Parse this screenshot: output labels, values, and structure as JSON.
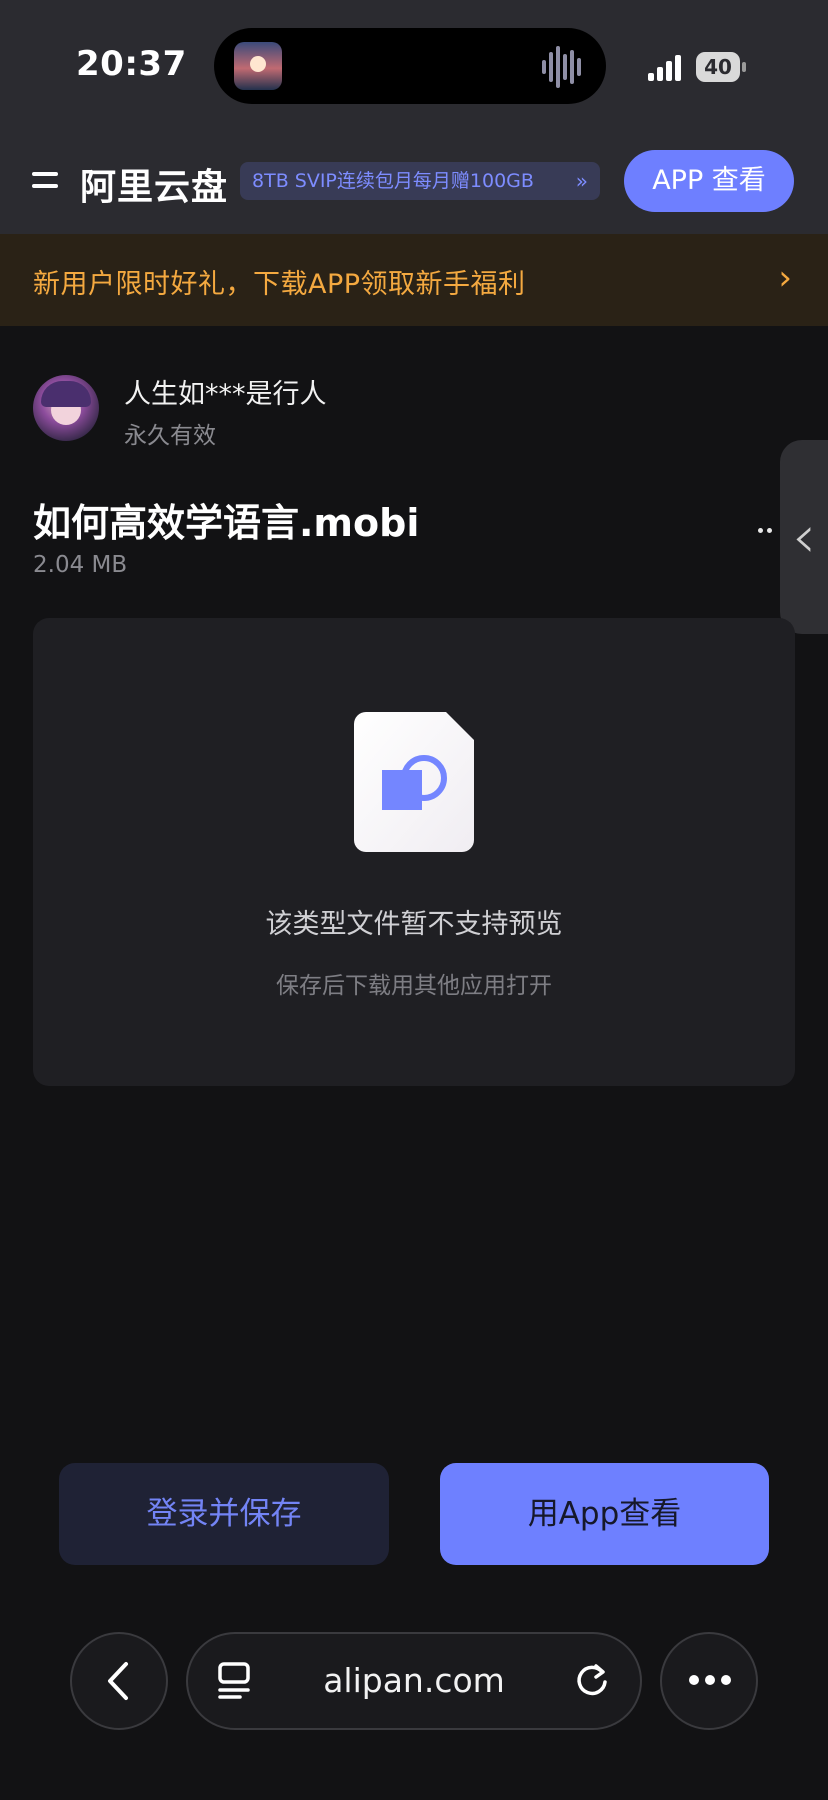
{
  "status": {
    "time": "20:37",
    "battery": "40"
  },
  "header": {
    "brand": "阿里云盘",
    "promo": "8TB SVIP连续包月每月赠100GB",
    "promo_chevron": "»",
    "app_button": "APP 查看"
  },
  "banner": {
    "text": "新用户限时好礼，下载APP领取新手福利",
    "arrow": "›"
  },
  "share": {
    "username": "人生如***是行人",
    "validity": "永久有效"
  },
  "file": {
    "name": "如何高效学语言.mobi",
    "size": "2.04 MB"
  },
  "preview": {
    "message": "该类型文件暂不支持预览",
    "hint": "保存后下载用其他应用打开"
  },
  "actions": {
    "save": "登录并保存",
    "open": "用App查看"
  },
  "browser": {
    "url": "alipan.com"
  },
  "colors": {
    "accent": "#6e80ff",
    "banner_text": "#f4a940",
    "background": "#121214"
  }
}
